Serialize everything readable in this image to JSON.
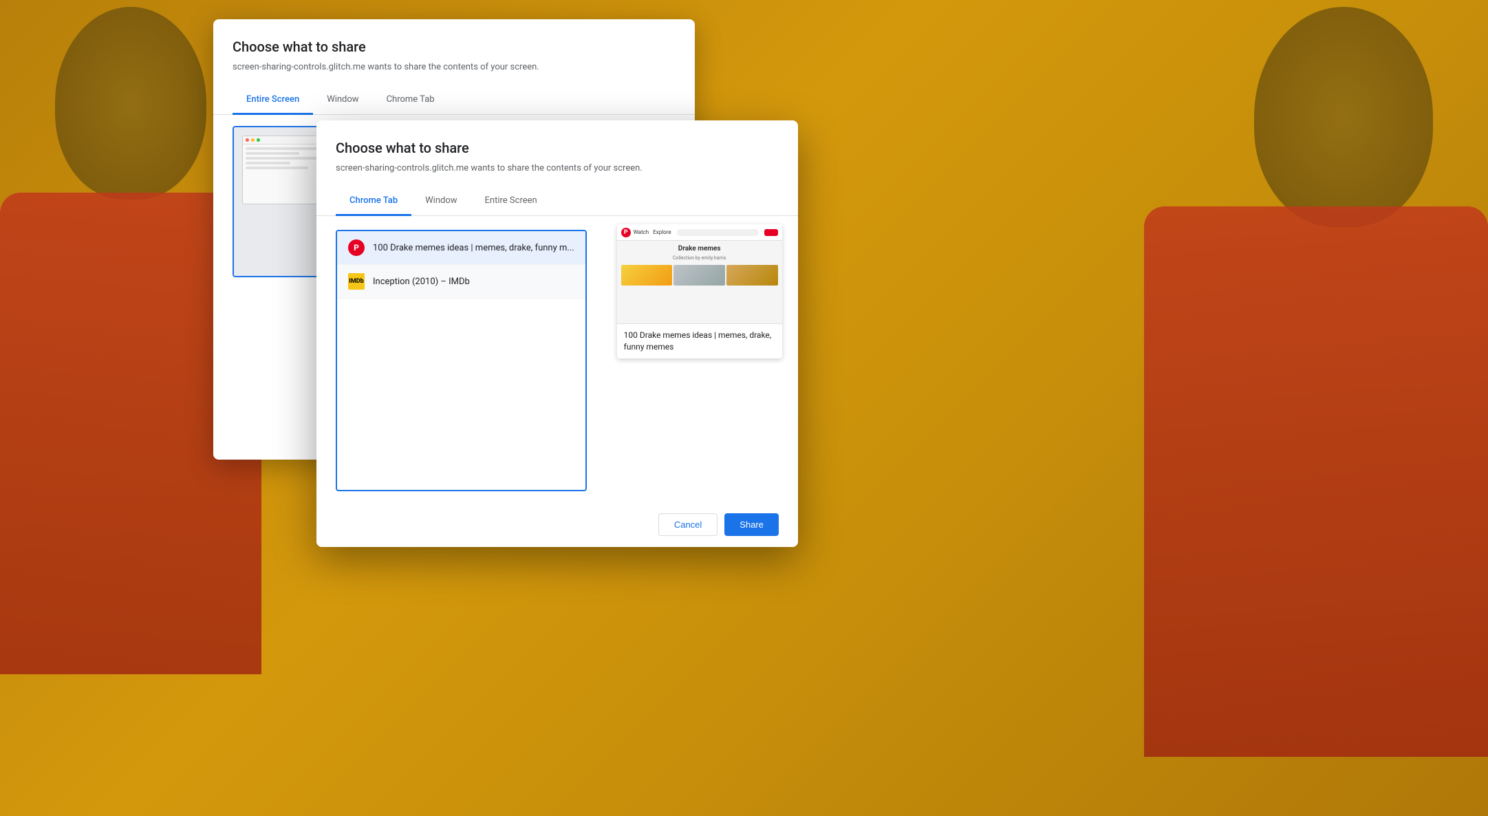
{
  "background": {
    "color": "#c8900a"
  },
  "dialog_back": {
    "title": "Choose what to share",
    "subtitle": "screen-sharing-controls.glitch.me wants to share the contents of your screen.",
    "tabs": [
      {
        "label": "Entire Screen",
        "active": true
      },
      {
        "label": "Window",
        "active": false
      },
      {
        "label": "Chrome Tab",
        "active": false
      }
    ]
  },
  "dialog_front": {
    "title": "Choose what to share",
    "subtitle": "screen-sharing-controls.glitch.me wants to share the contents of your screen.",
    "tabs": [
      {
        "label": "Chrome Tab",
        "active": true
      },
      {
        "label": "Window",
        "active": false
      },
      {
        "label": "Entire Screen",
        "active": false
      }
    ],
    "tab_items": [
      {
        "id": "pinterest-tab",
        "favicon_type": "pinterest",
        "favicon_label": "P",
        "title": "100 Drake memes ideas | memes, drake, funny m...",
        "selected": true
      },
      {
        "id": "imdb-tab",
        "favicon_type": "imdb",
        "favicon_label": "IMDb",
        "title": "Inception (2010) – IMDb",
        "selected": false
      }
    ],
    "preview": {
      "title": "100 Drake memes ideas | memes, drake, funny memes"
    },
    "buttons": {
      "cancel": "Cancel",
      "share": "Share"
    }
  }
}
